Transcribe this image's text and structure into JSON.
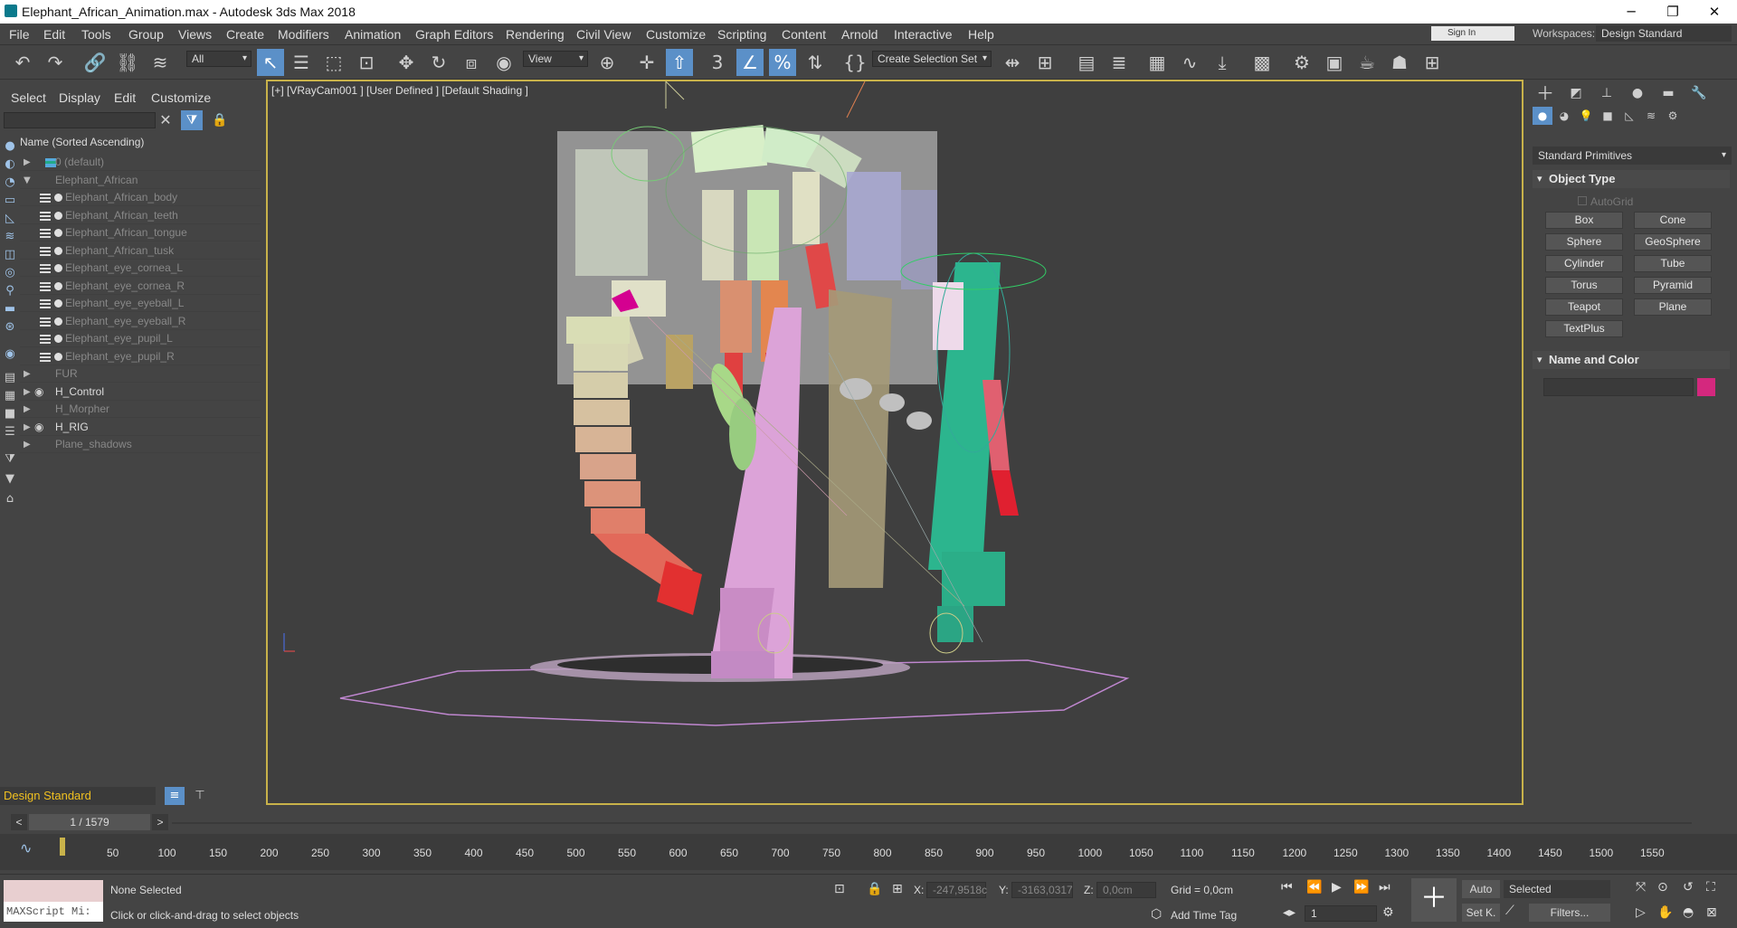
{
  "window": {
    "title": "Elephant_African_Animation.max - Autodesk 3ds Max 2018",
    "minimize": "─",
    "maximize": "❐",
    "close": "✕"
  },
  "menu": [
    "File",
    "Edit",
    "Tools",
    "Group",
    "Views",
    "Create",
    "Modifiers",
    "Animation",
    "Graph Editors",
    "Rendering",
    "Civil View",
    "Customize",
    "Scripting",
    "Content",
    "Arnold",
    "Interactive",
    "Help"
  ],
  "account": {
    "signin": "Sign In",
    "workspaces_label": "Workspaces:",
    "workspace": "Design Standard"
  },
  "toolbar": {
    "filter": "All",
    "refcoord": "View",
    "selection_set": "Create Selection Set",
    "snap": "3",
    "accent": "#5b90c8"
  },
  "explorer": {
    "tabs": [
      "Select",
      "Display",
      "Edit",
      "Customize"
    ],
    "column_header": "Name (Sorted Ascending)",
    "rows": [
      {
        "label": "0 (default)",
        "type": "layer",
        "expander": "▶",
        "bright": false
      },
      {
        "label": "Elephant_African",
        "type": "group",
        "expander": "▼",
        "bright": false
      },
      {
        "label": "Elephant_African_body",
        "type": "child",
        "bright": false
      },
      {
        "label": "Elephant_African_teeth",
        "type": "child",
        "bright": false
      },
      {
        "label": "Elephant_African_tongue",
        "type": "child",
        "bright": false
      },
      {
        "label": "Elephant_African_tusk",
        "type": "child",
        "bright": false
      },
      {
        "label": "Elephant_eye_cornea_L",
        "type": "child",
        "bright": false
      },
      {
        "label": "Elephant_eye_cornea_R",
        "type": "child",
        "bright": false
      },
      {
        "label": "Elephant_eye_eyeball_L",
        "type": "child",
        "bright": false
      },
      {
        "label": "Elephant_eye_eyeball_R",
        "type": "child",
        "bright": false
      },
      {
        "label": "Elephant_eye_pupil_L",
        "type": "child",
        "bright": false
      },
      {
        "label": "Elephant_eye_pupil_R",
        "type": "child",
        "bright": false
      },
      {
        "label": "FUR",
        "type": "group",
        "expander": "▶",
        "bright": false
      },
      {
        "label": "H_Control",
        "type": "group",
        "expander": "▶",
        "bright": true
      },
      {
        "label": "H_Morpher",
        "type": "group",
        "expander": "▶",
        "bright": false
      },
      {
        "label": "H_RIG",
        "type": "group",
        "expander": "▶",
        "bright": true
      },
      {
        "label": "Plane_shadows",
        "type": "group",
        "expander": "▶",
        "bright": false
      }
    ],
    "workspace_dropdown": "Design Standard"
  },
  "viewport": {
    "label": "[+] [VRayCam001 ] [User Defined ] [Default Shading ]",
    "border_color": "#c8b24a"
  },
  "command_panel": {
    "category": "Standard Primitives",
    "rollout_object_type": "Object Type",
    "autogrid": "AutoGrid",
    "primitives": [
      "Box",
      "Cone",
      "Sphere",
      "GeoSphere",
      "Cylinder",
      "Tube",
      "Torus",
      "Pyramid",
      "Teapot",
      "Plane",
      "TextPlus"
    ],
    "rollout_name_color": "Name and Color",
    "object_color": "#d4287e"
  },
  "timeline": {
    "frame": "1 / 1579",
    "prev": "<",
    "next": ">",
    "ticks": [
      "50",
      "100",
      "150",
      "200",
      "250",
      "300",
      "350",
      "400",
      "450",
      "500",
      "550",
      "600",
      "650",
      "700",
      "750",
      "800",
      "850",
      "900",
      "950",
      "1000",
      "1050",
      "1100",
      "1150",
      "1200",
      "1250",
      "1300",
      "1350",
      "1400",
      "1450",
      "1500",
      "1550"
    ]
  },
  "status": {
    "maxscript": "MAXScript Mi:",
    "selection": "None Selected",
    "prompt": "Click or click-and-drag to select objects",
    "x_label": "X:",
    "x_value": "-247,9518c",
    "y_label": "Y:",
    "y_value": "-3163,0317",
    "z_label": "Z:",
    "z_value": "0,0cm",
    "grid": "Grid = 0,0cm",
    "add_time_tag": "Add Time Tag",
    "auto": "Auto",
    "set_key": "Set K.",
    "key_filter": "Selected",
    "filters": "Filters...",
    "current_frame": "1"
  }
}
